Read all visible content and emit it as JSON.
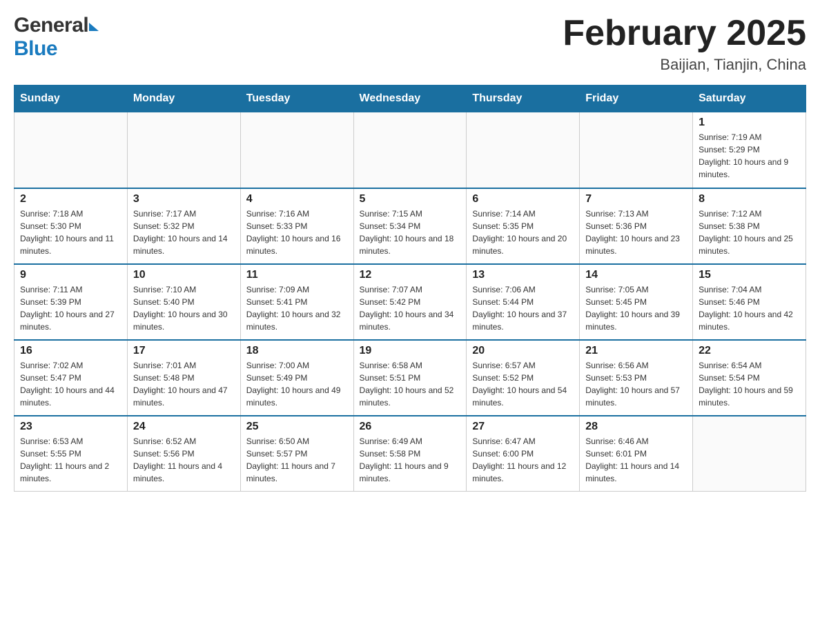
{
  "header": {
    "month_title": "February 2025",
    "location": "Baijian, Tianjin, China",
    "logo_general": "General",
    "logo_blue": "Blue"
  },
  "weekdays": [
    "Sunday",
    "Monday",
    "Tuesday",
    "Wednesday",
    "Thursday",
    "Friday",
    "Saturday"
  ],
  "weeks": [
    {
      "days": [
        {
          "num": "",
          "info": ""
        },
        {
          "num": "",
          "info": ""
        },
        {
          "num": "",
          "info": ""
        },
        {
          "num": "",
          "info": ""
        },
        {
          "num": "",
          "info": ""
        },
        {
          "num": "",
          "info": ""
        },
        {
          "num": "1",
          "info": "Sunrise: 7:19 AM\nSunset: 5:29 PM\nDaylight: 10 hours and 9 minutes."
        }
      ]
    },
    {
      "days": [
        {
          "num": "2",
          "info": "Sunrise: 7:18 AM\nSunset: 5:30 PM\nDaylight: 10 hours and 11 minutes."
        },
        {
          "num": "3",
          "info": "Sunrise: 7:17 AM\nSunset: 5:32 PM\nDaylight: 10 hours and 14 minutes."
        },
        {
          "num": "4",
          "info": "Sunrise: 7:16 AM\nSunset: 5:33 PM\nDaylight: 10 hours and 16 minutes."
        },
        {
          "num": "5",
          "info": "Sunrise: 7:15 AM\nSunset: 5:34 PM\nDaylight: 10 hours and 18 minutes."
        },
        {
          "num": "6",
          "info": "Sunrise: 7:14 AM\nSunset: 5:35 PM\nDaylight: 10 hours and 20 minutes."
        },
        {
          "num": "7",
          "info": "Sunrise: 7:13 AM\nSunset: 5:36 PM\nDaylight: 10 hours and 23 minutes."
        },
        {
          "num": "8",
          "info": "Sunrise: 7:12 AM\nSunset: 5:38 PM\nDaylight: 10 hours and 25 minutes."
        }
      ]
    },
    {
      "days": [
        {
          "num": "9",
          "info": "Sunrise: 7:11 AM\nSunset: 5:39 PM\nDaylight: 10 hours and 27 minutes."
        },
        {
          "num": "10",
          "info": "Sunrise: 7:10 AM\nSunset: 5:40 PM\nDaylight: 10 hours and 30 minutes."
        },
        {
          "num": "11",
          "info": "Sunrise: 7:09 AM\nSunset: 5:41 PM\nDaylight: 10 hours and 32 minutes."
        },
        {
          "num": "12",
          "info": "Sunrise: 7:07 AM\nSunset: 5:42 PM\nDaylight: 10 hours and 34 minutes."
        },
        {
          "num": "13",
          "info": "Sunrise: 7:06 AM\nSunset: 5:44 PM\nDaylight: 10 hours and 37 minutes."
        },
        {
          "num": "14",
          "info": "Sunrise: 7:05 AM\nSunset: 5:45 PM\nDaylight: 10 hours and 39 minutes."
        },
        {
          "num": "15",
          "info": "Sunrise: 7:04 AM\nSunset: 5:46 PM\nDaylight: 10 hours and 42 minutes."
        }
      ]
    },
    {
      "days": [
        {
          "num": "16",
          "info": "Sunrise: 7:02 AM\nSunset: 5:47 PM\nDaylight: 10 hours and 44 minutes."
        },
        {
          "num": "17",
          "info": "Sunrise: 7:01 AM\nSunset: 5:48 PM\nDaylight: 10 hours and 47 minutes."
        },
        {
          "num": "18",
          "info": "Sunrise: 7:00 AM\nSunset: 5:49 PM\nDaylight: 10 hours and 49 minutes."
        },
        {
          "num": "19",
          "info": "Sunrise: 6:58 AM\nSunset: 5:51 PM\nDaylight: 10 hours and 52 minutes."
        },
        {
          "num": "20",
          "info": "Sunrise: 6:57 AM\nSunset: 5:52 PM\nDaylight: 10 hours and 54 minutes."
        },
        {
          "num": "21",
          "info": "Sunrise: 6:56 AM\nSunset: 5:53 PM\nDaylight: 10 hours and 57 minutes."
        },
        {
          "num": "22",
          "info": "Sunrise: 6:54 AM\nSunset: 5:54 PM\nDaylight: 10 hours and 59 minutes."
        }
      ]
    },
    {
      "days": [
        {
          "num": "23",
          "info": "Sunrise: 6:53 AM\nSunset: 5:55 PM\nDaylight: 11 hours and 2 minutes."
        },
        {
          "num": "24",
          "info": "Sunrise: 6:52 AM\nSunset: 5:56 PM\nDaylight: 11 hours and 4 minutes."
        },
        {
          "num": "25",
          "info": "Sunrise: 6:50 AM\nSunset: 5:57 PM\nDaylight: 11 hours and 7 minutes."
        },
        {
          "num": "26",
          "info": "Sunrise: 6:49 AM\nSunset: 5:58 PM\nDaylight: 11 hours and 9 minutes."
        },
        {
          "num": "27",
          "info": "Sunrise: 6:47 AM\nSunset: 6:00 PM\nDaylight: 11 hours and 12 minutes."
        },
        {
          "num": "28",
          "info": "Sunrise: 6:46 AM\nSunset: 6:01 PM\nDaylight: 11 hours and 14 minutes."
        },
        {
          "num": "",
          "info": ""
        }
      ]
    }
  ]
}
